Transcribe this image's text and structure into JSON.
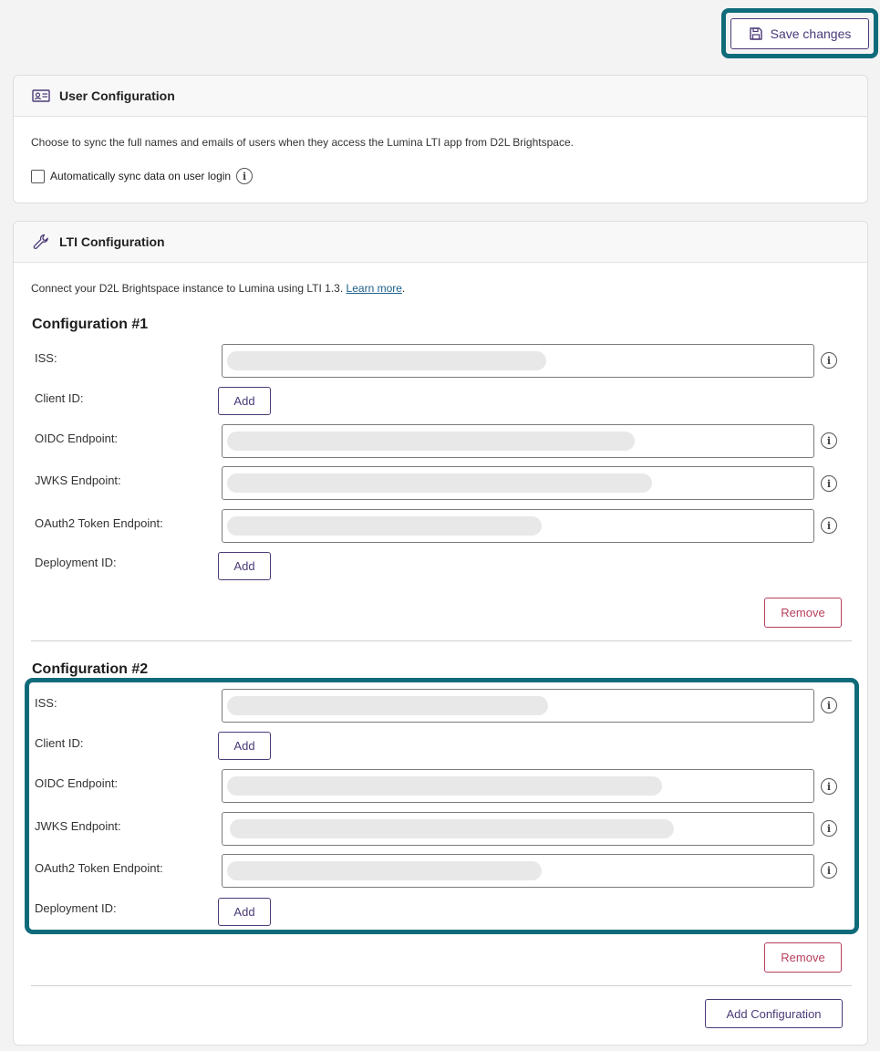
{
  "toolbar": {
    "save_label": "Save changes"
  },
  "user_config": {
    "title": "User Configuration",
    "description": "Choose to sync the full names and emails of users when they access the Lumina LTI app from D2L Brightspace.",
    "checkbox_label": "Automatically sync data on user login"
  },
  "lti_config": {
    "title": "LTI Configuration",
    "description": "Connect your D2L Brightspace instance to Lumina using LTI 1.3.",
    "learn_more": "Learn more",
    "period": ".",
    "add_configuration_label": "Add Configuration",
    "configs": [
      {
        "title": "Configuration #1",
        "iss_label": "ISS:",
        "client_id_label": "Client ID:",
        "oidc_label": "OIDC Endpoint:",
        "jwks_label": "JWKS Endpoint:",
        "oauth_label": "OAuth2 Token Endpoint:",
        "deployment_label": "Deployment ID:",
        "add_label": "Add",
        "remove_label": "Remove"
      },
      {
        "title": "Configuration #2",
        "iss_label": "ISS:",
        "client_id_label": "Client ID:",
        "oidc_label": "OIDC Endpoint:",
        "jwks_label": "JWKS Endpoint:",
        "oauth_label": "OAuth2 Token Endpoint:",
        "deployment_label": "Deployment ID:",
        "add_label": "Add",
        "remove_label": "Remove"
      }
    ]
  },
  "icons": {
    "save": "floppy-disk-icon",
    "user_card": "id-card-icon",
    "lti": "wrench-icon",
    "info": "info-icon"
  },
  "colors": {
    "accent": "#4b3a78",
    "danger": "#b83e5c",
    "highlight": "#0f6b7a"
  }
}
